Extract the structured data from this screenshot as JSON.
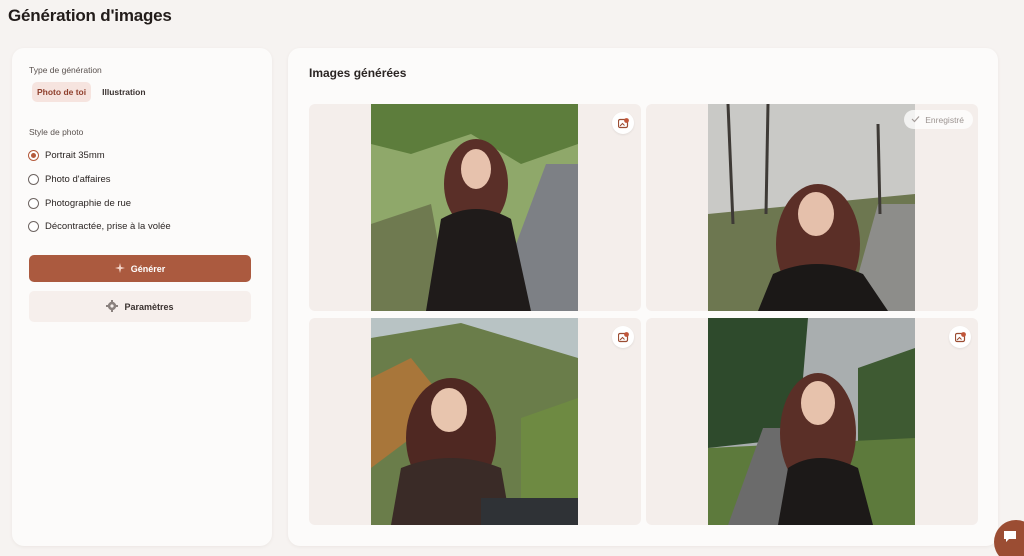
{
  "page": {
    "title": "Génération d'images"
  },
  "left": {
    "generation_type_label": "Type de génération",
    "generation_types": [
      {
        "label": "Photo de toi",
        "active": true
      },
      {
        "label": "Illustration",
        "active": false
      }
    ],
    "photo_style_label": "Style de photo",
    "photo_styles": [
      {
        "label": "Portrait 35mm",
        "checked": true
      },
      {
        "label": "Photo d'affaires",
        "checked": false
      },
      {
        "label": "Photographie de rue",
        "checked": false
      },
      {
        "label": "Décontractée, prise à la volée",
        "checked": false
      }
    ],
    "generate_label": "Générer",
    "settings_label": "Paramètres"
  },
  "right": {
    "title": "Images générées",
    "images": [
      {
        "saved": false,
        "icon": "save-image-icon"
      },
      {
        "saved": true,
        "saved_label": "Enregistré",
        "icon": "check-icon"
      },
      {
        "saved": false,
        "icon": "save-image-icon"
      },
      {
        "saved": false,
        "icon": "save-image-icon"
      }
    ]
  },
  "colors": {
    "accent": "#ab5a3f",
    "accent_light": "#f6e4df",
    "background": "#f6f3f1",
    "panel": "#fcfbfa"
  }
}
